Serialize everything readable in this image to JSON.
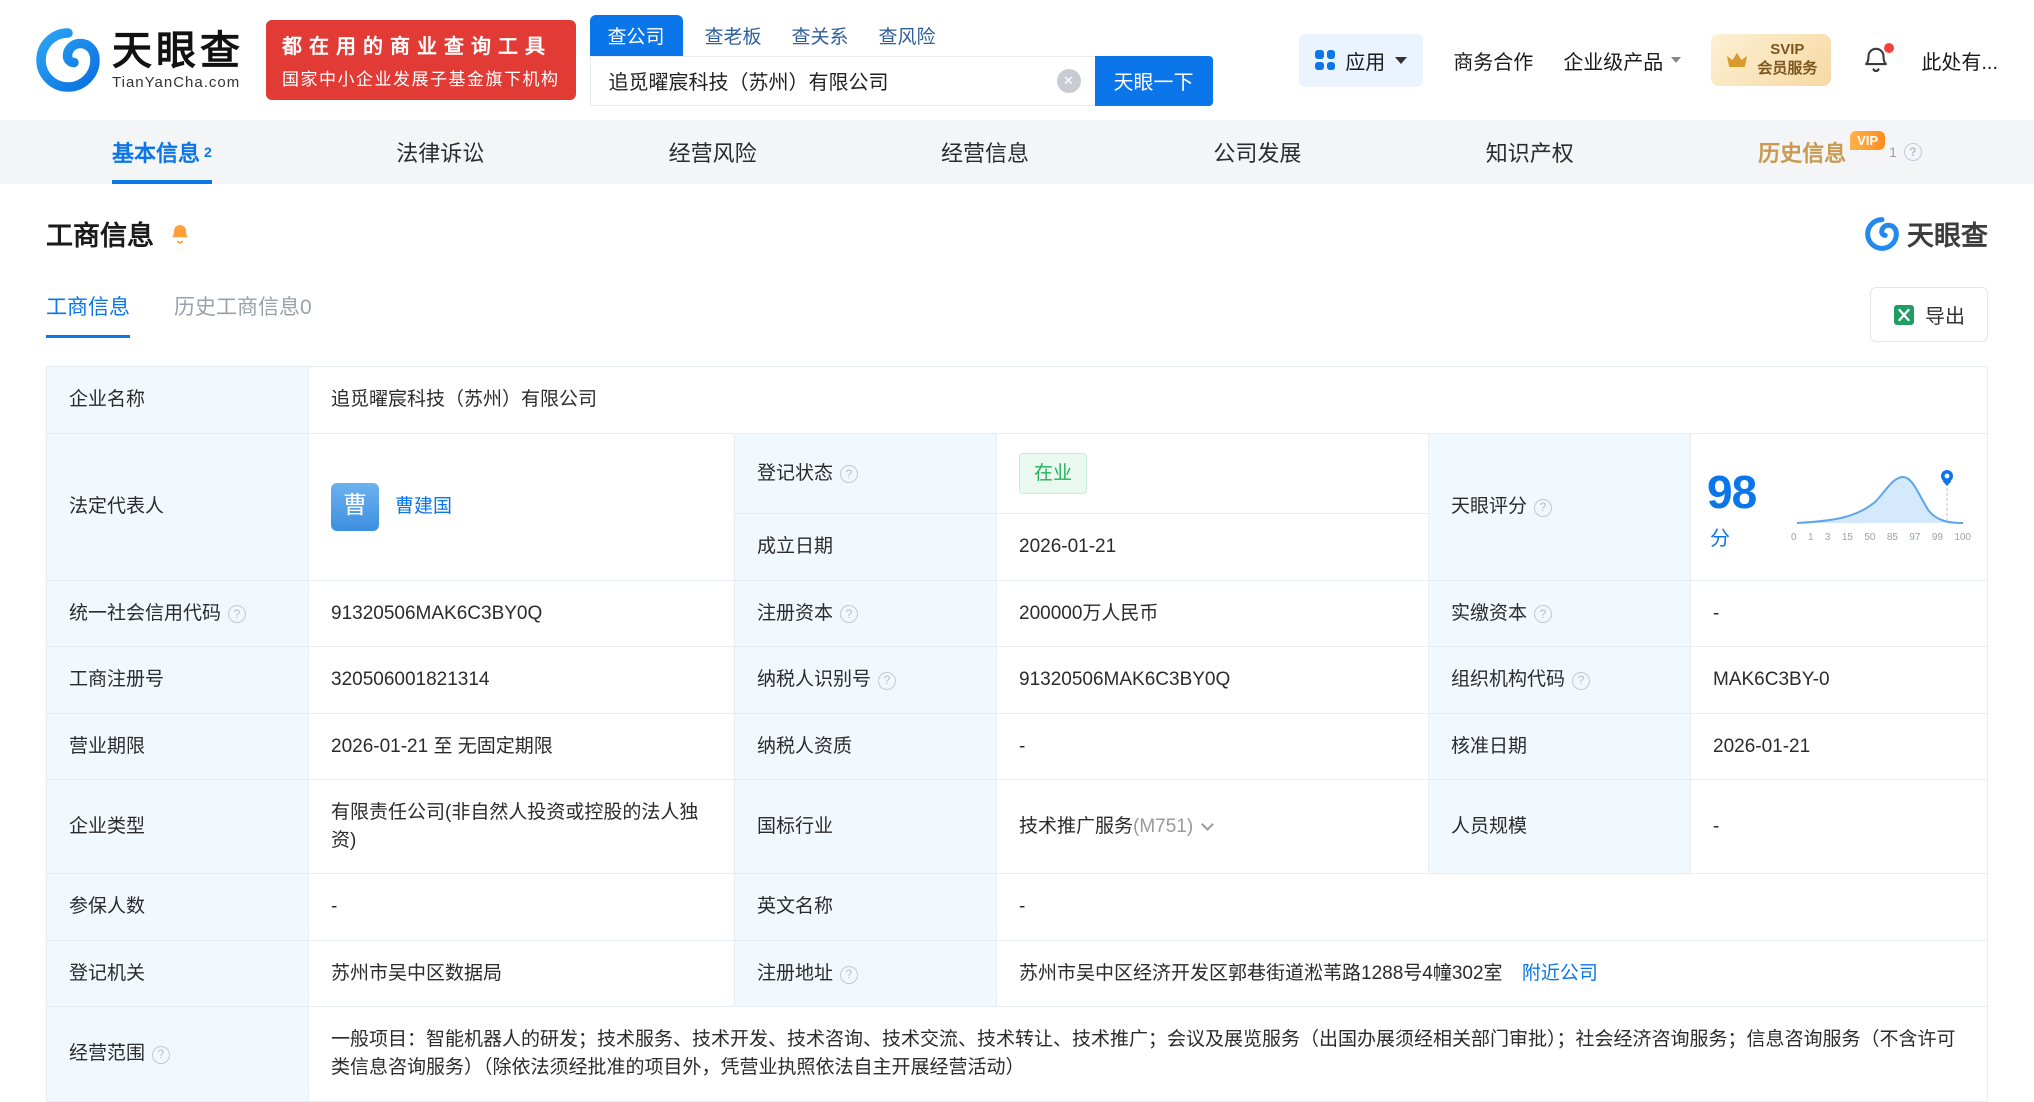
{
  "brand": {
    "logo_cn": "天眼查",
    "logo_en": "TianYanCha.com",
    "slogan_line1": "都在用的商业查询工具",
    "slogan_line2": "国家中小企业发展子基金旗下机构"
  },
  "search": {
    "tabs": [
      {
        "label": "查公司"
      },
      {
        "label": "查老板"
      },
      {
        "label": "查关系"
      },
      {
        "label": "查风险"
      }
    ],
    "value": "追觅曜宸科技（苏州）有限公司",
    "button": "天眼一下"
  },
  "header_nav": {
    "apps": "应用",
    "cooperation": "商务合作",
    "enterprise": "企业级产品",
    "svip_top": "SVIP",
    "svip_bottom": "会员服务",
    "user": "此处有..."
  },
  "page_tabs": [
    {
      "label": "基本信息",
      "count": "2"
    },
    {
      "label": "法律诉讼",
      "count": ""
    },
    {
      "label": "经营风险",
      "count": ""
    },
    {
      "label": "经营信息",
      "count": ""
    },
    {
      "label": "公司发展",
      "count": ""
    },
    {
      "label": "知识产权",
      "count": ""
    },
    {
      "label": "历史信息",
      "count": "1",
      "badge": "VIP"
    }
  ],
  "section": {
    "title": "工商信息",
    "watermark": "天眼查",
    "subtabs": [
      {
        "label": "工商信息"
      },
      {
        "label": "历史工商信息0"
      }
    ],
    "export_label": "导出"
  },
  "biz": {
    "name": {
      "label": "企业名称",
      "value": "追觅曜宸科技（苏州）有限公司"
    },
    "legal_rep": {
      "label": "法定代表人",
      "avatar": "曹",
      "value": "曹建国"
    },
    "reg_status": {
      "label": "登记状态",
      "value": "在业"
    },
    "establish_date": {
      "label": "成立日期",
      "value": "2026-01-21"
    },
    "score": {
      "label": "天眼评分",
      "value": "98",
      "unit": "分",
      "axis": [
        "0",
        "1",
        "3",
        "15",
        "50",
        "85",
        "97",
        "99",
        "100"
      ]
    },
    "credit_code": {
      "label": "统一社会信用代码",
      "value": "91320506MAK6C3BY0Q"
    },
    "reg_capital": {
      "label": "注册资本",
      "value": "200000万人民币"
    },
    "paid_capital": {
      "label": "实缴资本",
      "value": "-"
    },
    "reg_no": {
      "label": "工商注册号",
      "value": "320506001821314"
    },
    "taxpayer_id": {
      "label": "纳税人识别号",
      "value": "91320506MAK6C3BY0Q"
    },
    "org_code": {
      "label": "组织机构代码",
      "value": "MAK6C3BY-0"
    },
    "term": {
      "label": "营业期限",
      "value": "2026-01-21 至 无固定期限"
    },
    "taxpayer_quality": {
      "label": "纳税人资质",
      "value": "-"
    },
    "approval_date": {
      "label": "核准日期",
      "value": "2026-01-21"
    },
    "company_type": {
      "label": "企业类型",
      "value": "有限责任公司(非自然人投资或控股的法人独资)"
    },
    "industry": {
      "label": "国标行业",
      "value": "技术推广服务",
      "code": "(M751)"
    },
    "staff_size": {
      "label": "人员规模",
      "value": "-"
    },
    "insured": {
      "label": "参保人数",
      "value": "-"
    },
    "english_name": {
      "label": "英文名称",
      "value": "-"
    },
    "registry": {
      "label": "登记机关",
      "value": "苏州市吴中区数据局"
    },
    "address": {
      "label": "注册地址",
      "value": "苏州市吴中区经济开发区郭巷街道淞苇路1288号4幢302室",
      "link": "附近公司"
    },
    "scope": {
      "label": "经营范围",
      "value": "一般项目：智能机器人的研发；技术服务、技术开发、技术咨询、技术交流、技术转让、技术推广；会议及展览服务（出国办展须经相关部门审批）；社会经济咨询服务；信息咨询服务（不含许可类信息咨询服务）（除依法须经批准的项目外，凭营业执照依法自主开展经营活动）"
    }
  },
  "glyphs": {
    "help": "?",
    "clear": "✕"
  },
  "colors": {
    "brand_blue": "#0b75ea",
    "badge_red": "#e23a34",
    "status_green": "#26b15a",
    "vip_orange": "#ff8c1f",
    "history_gold": "#c9994f"
  }
}
